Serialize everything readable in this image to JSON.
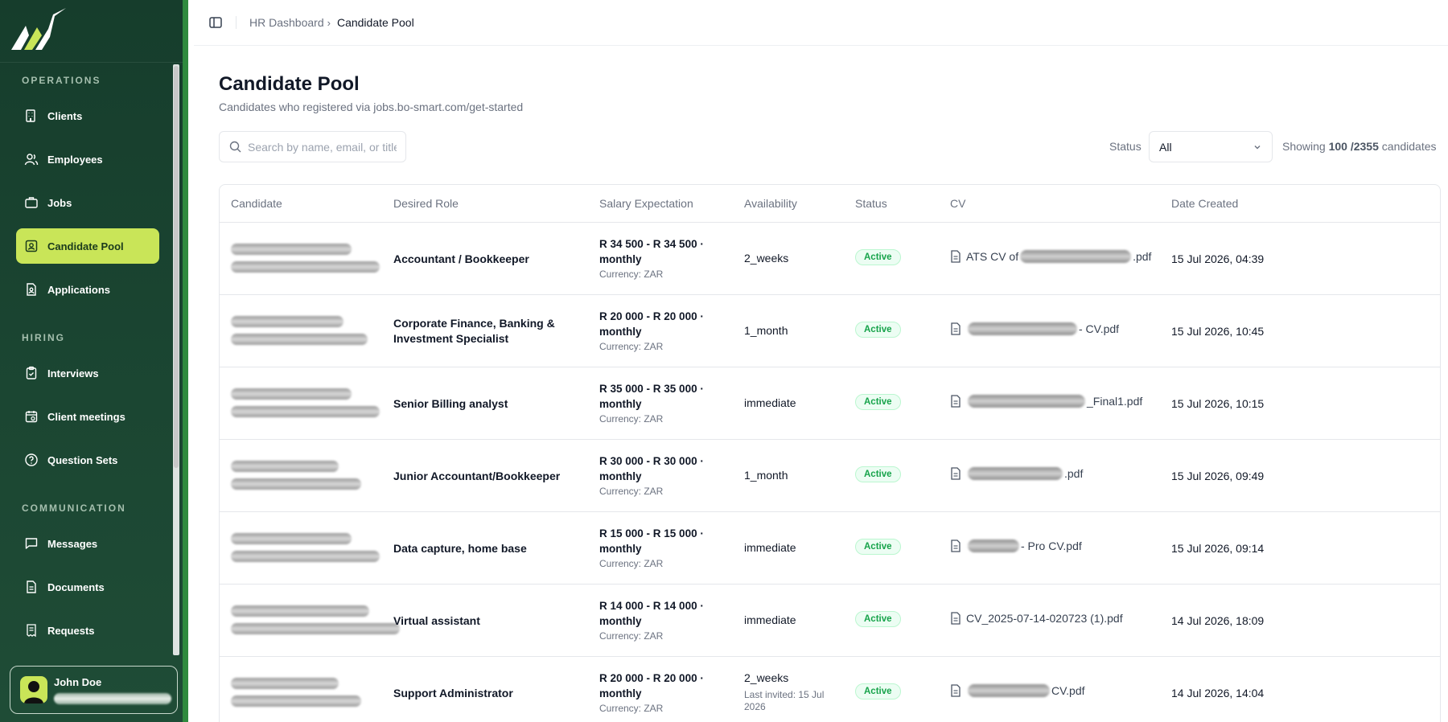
{
  "breadcrumb": {
    "parent": "HR Dashboard",
    "current": "Candidate Pool"
  },
  "sidebar": {
    "sections": [
      {
        "label": "OPERATIONS",
        "items": [
          {
            "label": "Clients",
            "icon": "building-icon"
          },
          {
            "label": "Employees",
            "icon": "users-icon"
          },
          {
            "label": "Jobs",
            "icon": "briefcase-icon"
          },
          {
            "label": "Candidate Pool",
            "icon": "id-card-icon",
            "active": true
          },
          {
            "label": "Applications",
            "icon": "file-user-icon"
          }
        ]
      },
      {
        "label": "HIRING",
        "items": [
          {
            "label": "Interviews",
            "icon": "clipboard-icon"
          },
          {
            "label": "Client meetings",
            "icon": "calendar-icon"
          },
          {
            "label": "Question Sets",
            "icon": "help-circle-icon"
          }
        ]
      },
      {
        "label": "COMMUNICATION",
        "items": [
          {
            "label": "Messages",
            "icon": "message-icon"
          },
          {
            "label": "Documents",
            "icon": "document-icon"
          },
          {
            "label": "Requests",
            "icon": "receipt-icon"
          }
        ]
      }
    ],
    "user": {
      "name": "John Doe"
    }
  },
  "page": {
    "title": "Candidate Pool",
    "subtitle": "Candidates who registered via jobs.bo-smart.com/get-started"
  },
  "toolbar": {
    "search_placeholder": "Search by name, email, or title",
    "status_label": "Status",
    "status_value": "All",
    "showing_prefix": "Showing",
    "showing_count": "100 /2355",
    "showing_suffix": "candidates"
  },
  "table": {
    "columns": [
      "Candidate",
      "Desired Role",
      "Salary Expectation",
      "Availability",
      "Status",
      "CV",
      "Date Created"
    ],
    "rows": [
      {
        "role_lines": [
          "Accountant / Bookkeeper"
        ],
        "salary_lines": [
          "R 34 500 - R 34 500 ·",
          "monthly"
        ],
        "currency": "Currency: ZAR",
        "availability": "2_weeks",
        "status": "Active",
        "cv_prefix": "ATS CV of",
        "cv_suffix": ".pdf",
        "date": "15 Jul 2026, 04:39"
      },
      {
        "role_lines": [
          "Corporate Finance, Banking &",
          "Investment Specialist"
        ],
        "salary_lines": [
          "R 20 000 - R 20 000 ·",
          "monthly"
        ],
        "currency": "Currency: ZAR",
        "availability": "1_month",
        "status": "Active",
        "cv_prefix": "",
        "cv_suffix": "- CV.pdf",
        "date": "15 Jul 2026, 10:45"
      },
      {
        "role_lines": [
          "Senior Billing analyst"
        ],
        "salary_lines": [
          "R 35 000 - R 35 000 ·",
          "monthly"
        ],
        "currency": "Currency: ZAR",
        "availability": "immediate",
        "status": "Active",
        "cv_prefix": "",
        "cv_suffix": "_Final1.pdf",
        "date": "15 Jul 2026, 10:15"
      },
      {
        "role_lines": [
          "Junior Accountant/Bookkeeper"
        ],
        "salary_lines": [
          "R 30 000 - R 30 000 ·",
          "monthly"
        ],
        "currency": "Currency: ZAR",
        "availability": "1_month",
        "status": "Active",
        "cv_prefix": "",
        "cv_suffix": ".pdf",
        "date": "15 Jul 2026, 09:49"
      },
      {
        "role_lines": [
          "Data capture, home base"
        ],
        "salary_lines": [
          "R 15 000 - R 15 000 ·",
          "monthly"
        ],
        "currency": "Currency: ZAR",
        "availability": "immediate",
        "status": "Active",
        "cv_prefix": "",
        "cv_suffix": "- Pro CV.pdf",
        "date": "15 Jul 2026, 09:14"
      },
      {
        "role_lines": [
          "Virtual assistant"
        ],
        "salary_lines": [
          "R 14 000 - R 14 000 ·",
          "monthly"
        ],
        "currency": "Currency: ZAR",
        "availability": "immediate",
        "status": "Active",
        "cv_prefix": "CV_2025-07-14-020723 (1).pdf",
        "cv_suffix": "",
        "date": "14 Jul 2026, 18:09"
      },
      {
        "role_lines": [
          "Support Administrator"
        ],
        "salary_lines": [
          "R 20 000 - R 20 000 ·",
          "monthly"
        ],
        "currency": "Currency: ZAR",
        "availability": "2_weeks",
        "availability_note": "Last invited: 15 Jul 2026",
        "status": "Active",
        "cv_prefix": "",
        "cv_suffix": "CV.pdf",
        "date": "14 Jul 2026, 14:04"
      }
    ]
  },
  "colors": {
    "sidebar_bg": "#1b4632",
    "accent": "#c9e558",
    "status_active": "#16a34a"
  }
}
